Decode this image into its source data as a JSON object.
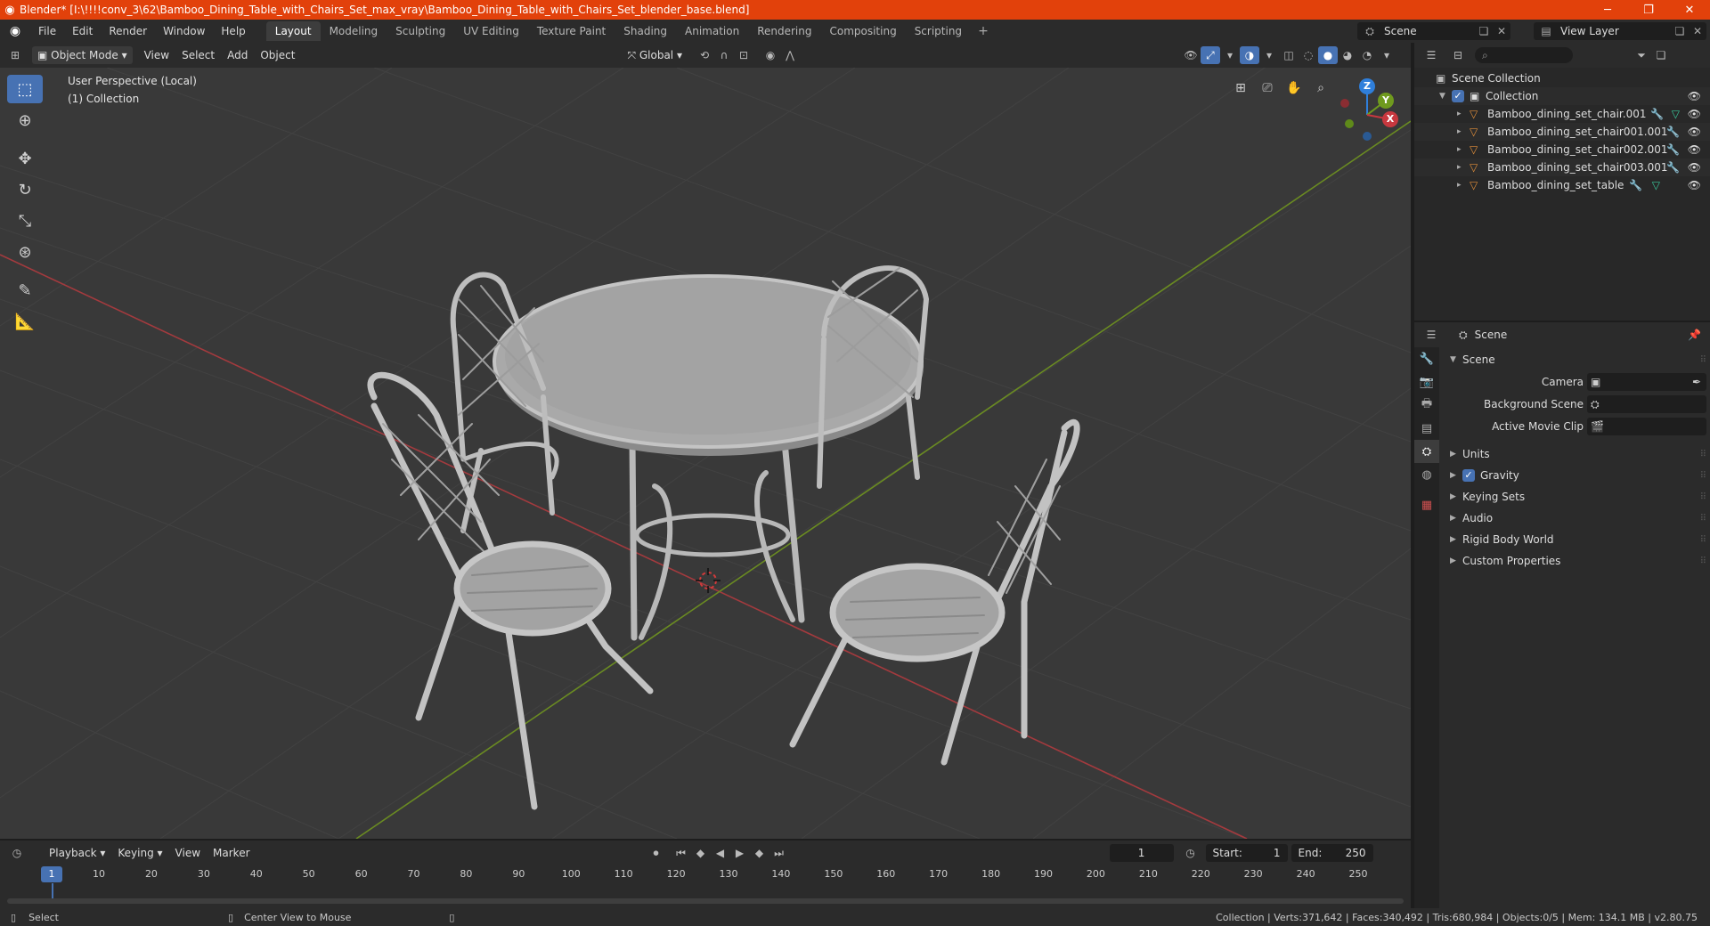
{
  "titlebar": {
    "title": "Blender* [I:\\!!!!conv_3\\62\\Bamboo_Dining_Table_with_Chairs_Set_max_vray\\Bamboo_Dining_Table_with_Chairs_Set_blender_base.blend]",
    "minimize": "─",
    "maximize": "❐",
    "close": "✕"
  },
  "menu": [
    "File",
    "Edit",
    "Render",
    "Window",
    "Help"
  ],
  "workspaces": [
    "Layout",
    "Modeling",
    "Sculpting",
    "UV Editing",
    "Texture Paint",
    "Shading",
    "Animation",
    "Rendering",
    "Compositing",
    "Scripting"
  ],
  "active_workspace": "Layout",
  "scene_name": "Scene",
  "view_layer_name": "View Layer",
  "viewport_header": {
    "mode": "Object Mode",
    "menus": [
      "View",
      "Select",
      "Add",
      "Object"
    ],
    "orientation": "Global"
  },
  "viewport": {
    "perspective_label": "User Perspective (Local)",
    "collection_label": "(1) Collection",
    "axis_x": "X",
    "axis_y": "Y",
    "axis_z": "Z"
  },
  "outliner": {
    "root": "Scene Collection",
    "collection": "Collection",
    "objects": [
      "Bamboo_dining_set_chair.001",
      "Bamboo_dining_set_chair001.001",
      "Bamboo_dining_set_chair002.001",
      "Bamboo_dining_set_chair003.001",
      "Bamboo_dining_set_table"
    ]
  },
  "properties": {
    "context": "Scene",
    "panel_title": "Scene",
    "camera_label": "Camera",
    "background_scene_label": "Background Scene",
    "active_movie_clip_label": "Active Movie Clip",
    "sections": [
      "Units",
      "Gravity",
      "Keying Sets",
      "Audio",
      "Rigid Body World",
      "Custom Properties"
    ],
    "gravity_enabled": true
  },
  "timeline": {
    "menus": [
      "Playback",
      "Keying",
      "View",
      "Marker"
    ],
    "current_frame": "1",
    "start_label": "Start:",
    "start": "1",
    "end_label": "End:",
    "end": "250",
    "ruler": [
      "1",
      "10",
      "20",
      "30",
      "40",
      "50",
      "60",
      "70",
      "80",
      "90",
      "100",
      "110",
      "120",
      "130",
      "140",
      "150",
      "160",
      "170",
      "180",
      "190",
      "200",
      "210",
      "220",
      "230",
      "240",
      "250"
    ]
  },
  "statusbar": {
    "left_action": "Select",
    "mid_action": "Center View to Mouse",
    "stats": "Collection | Verts:371,642 | Faces:340,492 | Tris:680,984 | Objects:0/5 | Mem: 134.1 MB | v2.80.75"
  },
  "colors": {
    "titlebar": "#e2410b",
    "accent": "#4772b3",
    "x_axis": "#c8383f",
    "y_axis": "#6f9a1e",
    "z_axis": "#2f7fdb",
    "object_orange": "#e08e3a"
  }
}
